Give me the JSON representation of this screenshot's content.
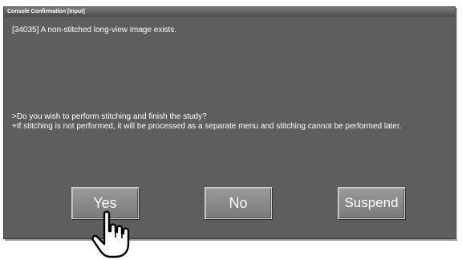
{
  "dialog": {
    "title": "Console Confirmation [Input]",
    "message_code_line": "[34035] A non-stitched long-view image exists.",
    "question_line": ">Do you wish to perform stitching and finish the study?",
    "note_line": "+If stitching is not performed, it will be processed as a separate menu and stitching cannot be performed later."
  },
  "buttons": {
    "yes_label": "Yes",
    "no_label": "No",
    "suspend_label": "Suspend"
  },
  "cursor": {
    "icon": "pointing-hand-icon"
  }
}
